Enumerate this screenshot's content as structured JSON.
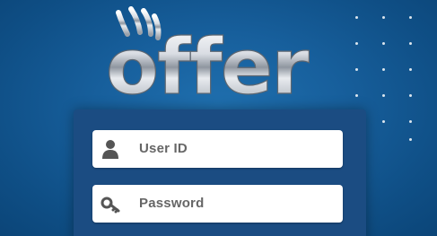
{
  "brand": {
    "logo_text": "offer"
  },
  "login": {
    "user_id_label": "User ID",
    "password_label": "Password"
  },
  "icons": {
    "user": "user-icon",
    "password": "key-icon"
  },
  "colors": {
    "background": "#175f9c",
    "panel": "#1b4c82",
    "field": "#ffffff",
    "label_text": "#666666"
  }
}
